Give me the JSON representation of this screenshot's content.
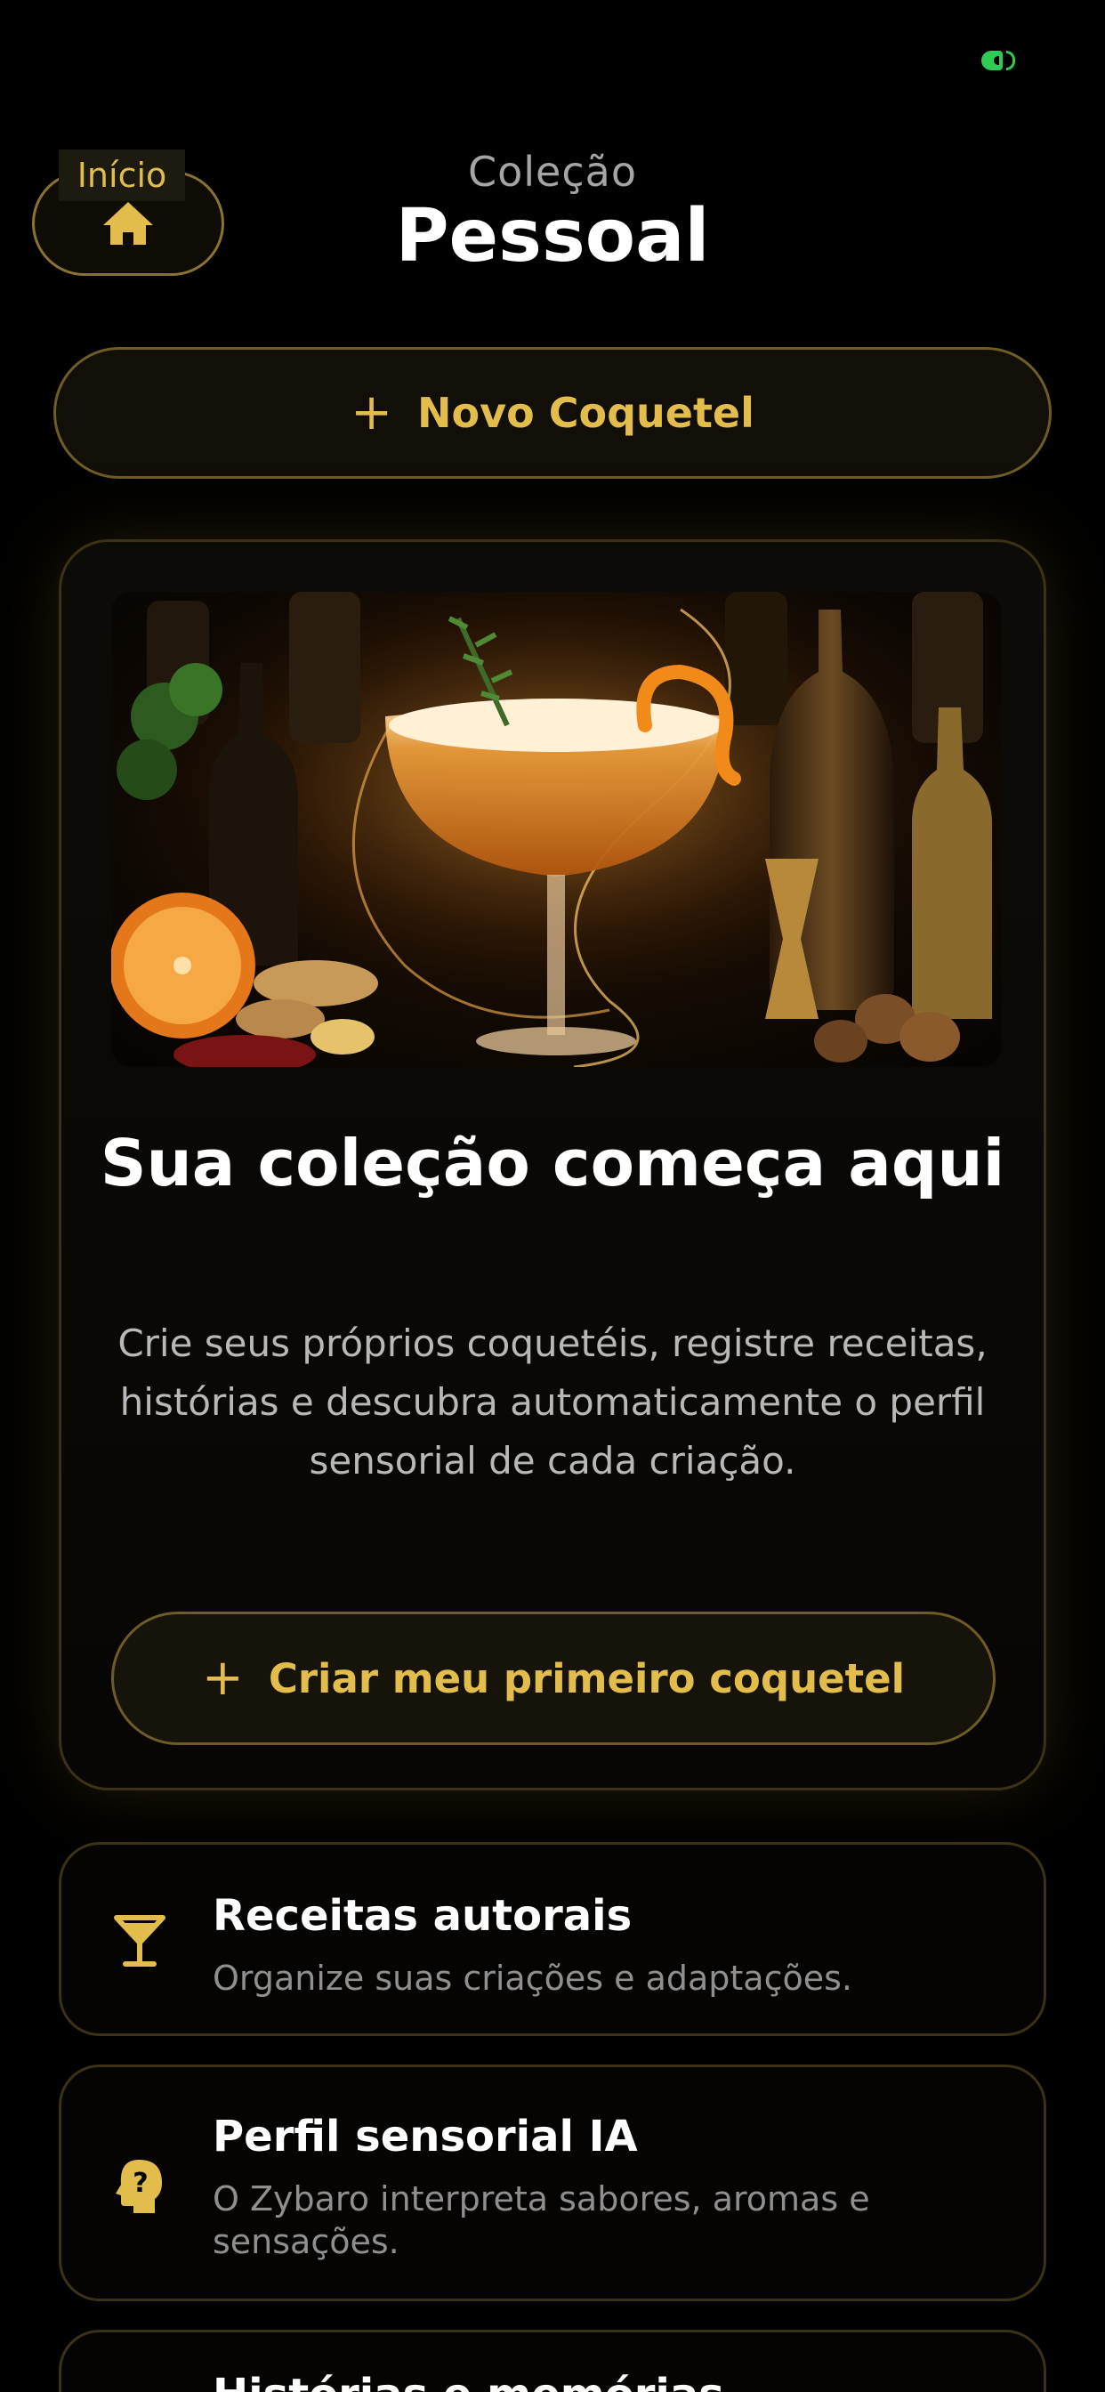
{
  "status_bar": {
    "battery_icon": "battery-charging-icon",
    "battery_color": "#2ecc55"
  },
  "header": {
    "home_label": "Início",
    "home_icon": "home-icon",
    "subtitle": "Coleção",
    "title": "Pessoal"
  },
  "new_button": {
    "label": "Novo Coquetel",
    "icon": "plus-icon"
  },
  "hero": {
    "image": "cocktail-coupe-image",
    "title": "Sua coleção começa aqui",
    "description": "Crie seus próprios coquetéis, registre receitas, histórias e descubra automaticamente o perfil sensorial de cada criação.",
    "cta_label": "Criar meu primeiro coquetel"
  },
  "features": [
    {
      "icon": "martini-glass-icon",
      "title": "Receitas autorais",
      "text": "Organize suas criações e adaptações."
    },
    {
      "icon": "head-question-icon",
      "title": "Perfil sensorial IA",
      "text": "O Zybaro interpreta sabores, aromas e sensações."
    },
    {
      "icon": "book-icon",
      "title": "Histórias e memórias",
      "text": ""
    }
  ],
  "colors": {
    "accent": "#e3bd4c",
    "border": "#6e5c24",
    "background": "#000000"
  }
}
